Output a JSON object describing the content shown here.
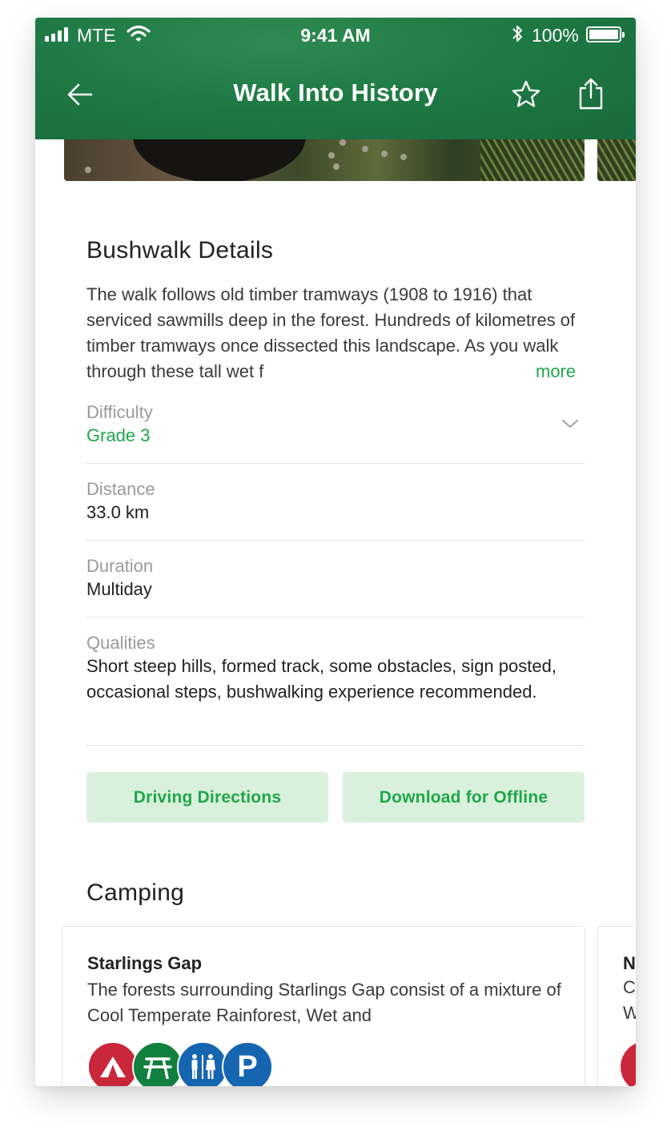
{
  "status_bar": {
    "carrier": "MTE",
    "time": "9:41 AM",
    "battery": "100%",
    "icons": [
      "signal-icon",
      "wifi-icon",
      "bluetooth-icon",
      "battery-icon"
    ]
  },
  "nav": {
    "title": "Walk Into History",
    "back_icon": "arrow-left-icon",
    "favorite_icon": "star-outline-icon",
    "share_icon": "share-icon"
  },
  "details": {
    "heading": "Bushwalk Details",
    "description": "The walk follows old timber tramways (1908 to 1916) that serviced sawmills deep in the forest. Hundreds of kilometres of timber tramways once dissected this landscape. As you walk through these tall wet f",
    "more_label": "more",
    "rows": [
      {
        "label": "Difficulty",
        "value": "Grade 3"
      },
      {
        "label": "Distance",
        "value": "33.0 km"
      },
      {
        "label": "Duration",
        "value": "Multiday"
      },
      {
        "label": "Qualities",
        "value": "Short steep hills, formed track, some obstacles, sign posted, occasional steps, bushwalking experience recommended."
      }
    ]
  },
  "actions": {
    "driving_directions": "Driving Directions",
    "download_offline": "Download for Offline"
  },
  "camping": {
    "heading": "Camping",
    "sites": [
      {
        "name": "Starlings Gap",
        "description": "The forests surrounding Starlings Gap consist of a mixture of Cool Temperate Rainforest, Wet and",
        "amenities": [
          {
            "icon": "camping-tent-icon",
            "color": "#c8283a"
          },
          {
            "icon": "picnic-table-icon",
            "color": "#11803e"
          },
          {
            "icon": "toilets-icon",
            "color": "#1565b0"
          },
          {
            "icon": "parking-icon",
            "color": "#1565b0"
          }
        ]
      },
      {
        "name_peek": "N",
        "desc_peek": [
          "C",
          "W"
        ]
      }
    ]
  },
  "colors": {
    "header_green": "#1f7a45",
    "accent_green": "#1fa64a",
    "button_bg": "#d9f1dc"
  }
}
